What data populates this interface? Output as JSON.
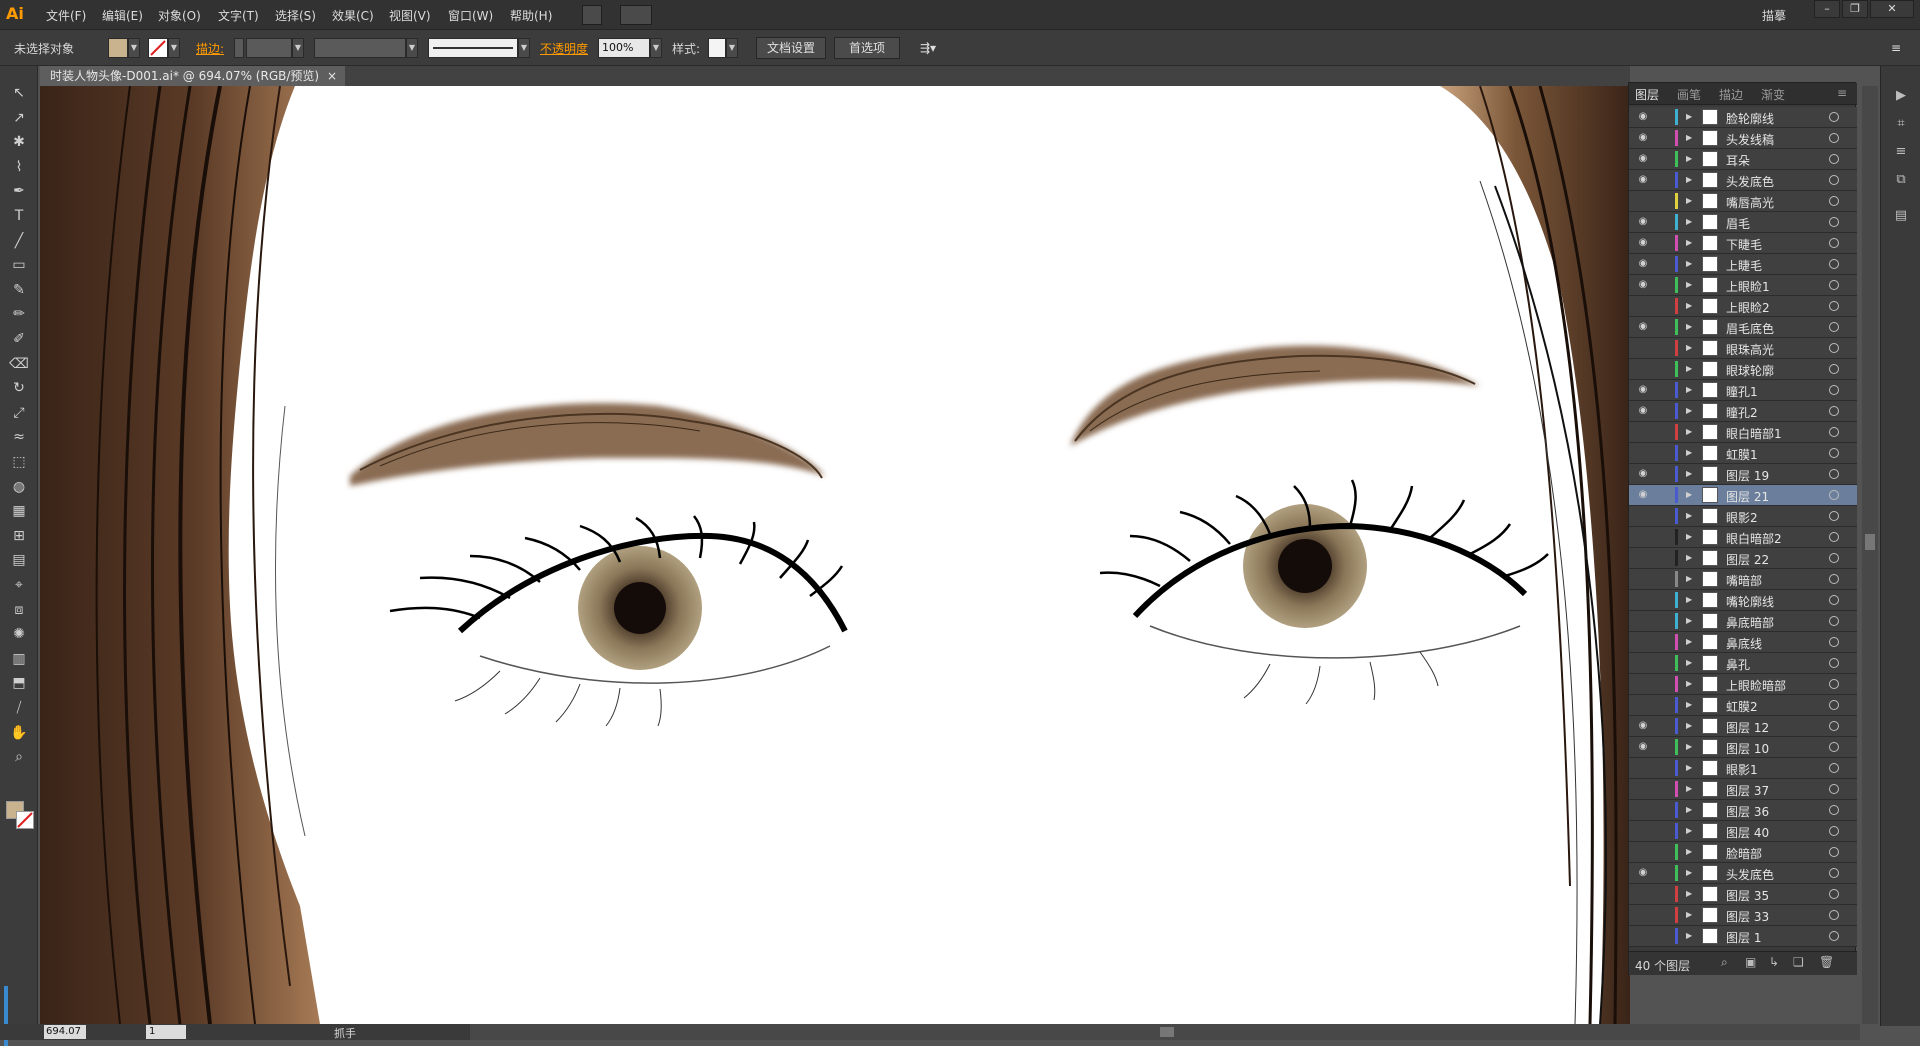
{
  "app": {
    "logo": "Ai",
    "menus": [
      "文件(F)",
      "编辑(E)",
      "对象(O)",
      "文字(T)",
      "选择(S)",
      "效果(C)",
      "视图(V)",
      "窗口(W)",
      "帮助(H)"
    ],
    "workspace": "描摹",
    "window_controls": [
      "–",
      "❐",
      "✕"
    ]
  },
  "control_bar": {
    "selection": "未选择对象",
    "stroke_label": "描边:",
    "opacity_label": "不透明度",
    "opacity_value": "100%",
    "style_label": "样式:",
    "doc_setup": "文档设置",
    "preferences": "首选项",
    "accent_color": "#ff9a00"
  },
  "document": {
    "tab_title": "时装人物头像-D001.ai* @ 694.07% (RGB/预览)",
    "tab_close": "×"
  },
  "status_bar": {
    "zoom": "694.07",
    "page": "1",
    "tool": "抓手"
  },
  "layers_panel": {
    "tabs": [
      "图层",
      "画笔",
      "描边",
      "渐变"
    ],
    "count": "40 个图层",
    "selected_index": 18,
    "rows": [
      {
        "name": "脸轮廓线",
        "visible": true,
        "color": "#3fb0d0"
      },
      {
        "name": "头发线稿",
        "visible": true,
        "color": "#d04fb0"
      },
      {
        "name": "耳朵",
        "visible": true,
        "color": "#3fbf5a"
      },
      {
        "name": "头发底色",
        "visible": true,
        "color": "#4a5ad0"
      },
      {
        "name": "嘴唇高光",
        "visible": false,
        "color": "#e0d040"
      },
      {
        "name": "眉毛",
        "visible": true,
        "color": "#3fb0d0"
      },
      {
        "name": "下睫毛",
        "visible": true,
        "color": "#d04fb0"
      },
      {
        "name": "上睫毛",
        "visible": true,
        "color": "#4a5ad0"
      },
      {
        "name": "上眼睑1",
        "visible": true,
        "color": "#3fbf5a"
      },
      {
        "name": "上眼睑2",
        "visible": false,
        "color": "#d04040"
      },
      {
        "name": "眉毛底色",
        "visible": true,
        "color": "#3fbf5a"
      },
      {
        "name": "眼珠高光",
        "visible": false,
        "color": "#d04040"
      },
      {
        "name": "眼球轮廓",
        "visible": false,
        "color": "#3fbf5a"
      },
      {
        "name": "瞳孔1",
        "visible": true,
        "color": "#4a5ad0"
      },
      {
        "name": "瞳孔2",
        "visible": true,
        "color": "#4a5ad0"
      },
      {
        "name": "眼白暗部1",
        "visible": false,
        "color": "#d04040"
      },
      {
        "name": "虹膜1",
        "visible": false,
        "color": "#4a5ad0"
      },
      {
        "name": "图层 19",
        "visible": true,
        "color": "#4a5ad0"
      },
      {
        "name": "图层 21",
        "visible": true,
        "color": "#4a5ad0"
      },
      {
        "name": "眼影2",
        "visible": false,
        "color": "#4a5ad0"
      },
      {
        "name": "眼白暗部2",
        "visible": false,
        "color": "#222222"
      },
      {
        "name": "图层 22",
        "visible": false,
        "color": "#222222"
      },
      {
        "name": "嘴暗部",
        "visible": false,
        "color": "#888888"
      },
      {
        "name": "嘴轮廓线",
        "visible": false,
        "color": "#3fb0d0"
      },
      {
        "name": "鼻底暗部",
        "visible": false,
        "color": "#3fb0d0"
      },
      {
        "name": "鼻底线",
        "visible": false,
        "color": "#d04fb0"
      },
      {
        "name": "鼻孔",
        "visible": false,
        "color": "#3fbf5a"
      },
      {
        "name": "上眼睑暗部",
        "visible": false,
        "color": "#d04fb0"
      },
      {
        "name": "虹膜2",
        "visible": false,
        "color": "#4a5ad0"
      },
      {
        "name": "图层 12",
        "visible": true,
        "color": "#4a5ad0"
      },
      {
        "name": "图层 10",
        "visible": true,
        "color": "#3fbf5a"
      },
      {
        "name": "眼影1",
        "visible": false,
        "color": "#4a5ad0"
      },
      {
        "name": "图层 37",
        "visible": false,
        "color": "#d04fb0"
      },
      {
        "name": "图层 36",
        "visible": false,
        "color": "#4a5ad0"
      },
      {
        "name": "图层 40",
        "visible": false,
        "color": "#4a5ad0"
      },
      {
        "name": "脸暗部",
        "visible": false,
        "color": "#3fbf5a"
      },
      {
        "name": "头发底色",
        "visible": true,
        "color": "#3fbf5a"
      },
      {
        "name": "图层 35",
        "visible": false,
        "color": "#d04040"
      },
      {
        "name": "图层 33",
        "visible": false,
        "color": "#d04040"
      },
      {
        "name": "图层 1",
        "visible": false,
        "color": "#4a5ad0"
      }
    ]
  },
  "tools": [
    "selection-tool",
    "direct-selection-tool",
    "magic-wand-tool",
    "lasso-tool",
    "pen-tool",
    "type-tool",
    "line-tool",
    "rectangle-tool",
    "paintbrush-tool",
    "pencil-tool",
    "blob-brush-tool",
    "eraser-tool",
    "rotate-tool",
    "scale-tool",
    "warp-tool",
    "free-transform-tool",
    "shape-builder-tool",
    "perspective-grid-tool",
    "mesh-tool",
    "gradient-tool",
    "eyedropper-tool",
    "blend-tool",
    "symbol-sprayer-tool",
    "graph-tool",
    "artboard-tool",
    "slice-tool",
    "hand-tool",
    "zoom-tool"
  ]
}
